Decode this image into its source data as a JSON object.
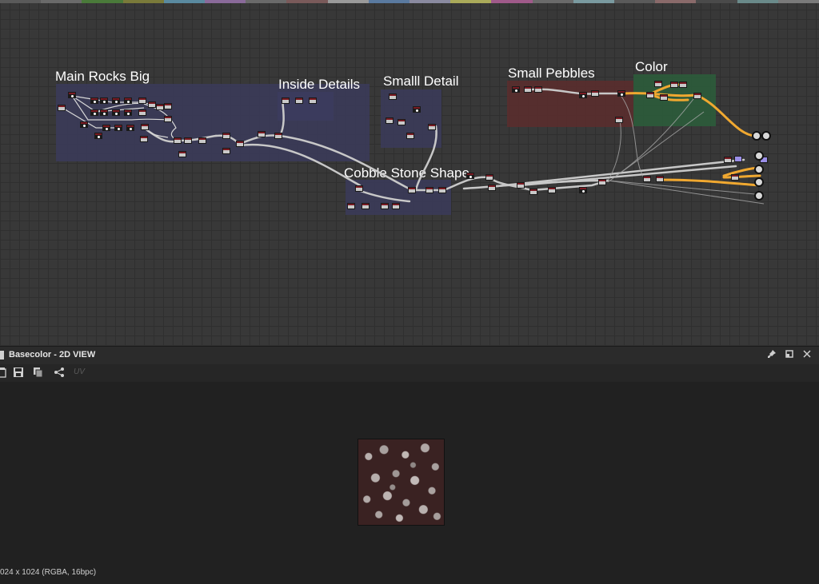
{
  "graph": {
    "frames": [
      {
        "id": "main-rocks-big",
        "title": "Main Rocks Big",
        "color": "#3b3b5a"
      },
      {
        "id": "inside-details",
        "title": "Inside Details",
        "color": "#3b3b5a"
      },
      {
        "id": "small-detail",
        "title": "Smalll Detail",
        "color": "#3b3b5a"
      },
      {
        "id": "cobble-stone-shape",
        "title": "Cobble Stone Shape",
        "color": "#3b3b5a"
      },
      {
        "id": "small-pebbles",
        "title": "Small Pebbles",
        "color": "#5a2e2e"
      },
      {
        "id": "color",
        "title": "Color",
        "color": "#2c5a3a"
      }
    ],
    "link_color": "#c8c8c8",
    "color_link_color": "#f0a830"
  },
  "panel": {
    "title": "Basecolor - 2D VIEW",
    "uv_label": "UV",
    "status": "024 x 1024 (RGBA, 16bpc)"
  },
  "icons": [
    "pin-icon",
    "maximize-icon",
    "close-icon",
    "export-icon",
    "save-icon",
    "copy-icon",
    "share-icon"
  ]
}
